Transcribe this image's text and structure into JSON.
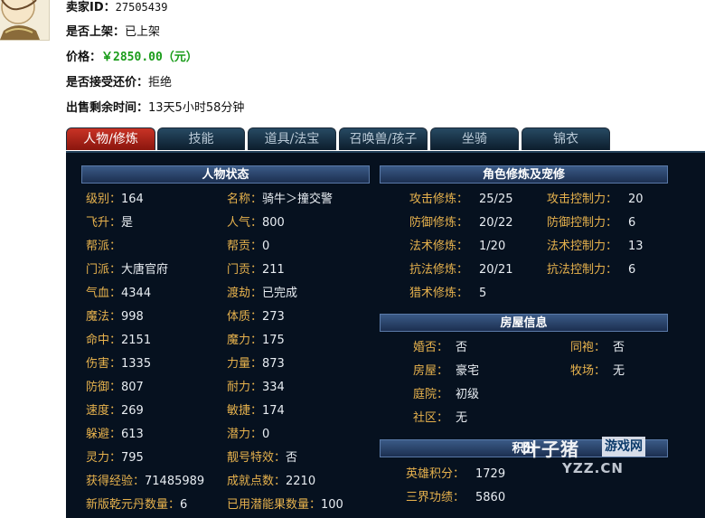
{
  "seller": {
    "seller_id_label": "卖家ID：",
    "seller_id": "27505439",
    "listed_label": "是否上架：",
    "listed": "已上架",
    "price_label": "价格：",
    "price": "￥2850.00（元）",
    "counter_offer_label": "是否接受还价：",
    "counter_offer": "拒绝",
    "time_left_label": "出售剩余时间：",
    "time_left": "13天5小时58分钟"
  },
  "tabs": [
    "人物/修炼",
    "技能",
    "道具/法宝",
    "召唤兽/孩子",
    "坐骑",
    "锦衣"
  ],
  "character": {
    "title": "人物状态",
    "rows": [
      [
        {
          "k": "级别：",
          "v": "164"
        },
        {
          "k": "名称：",
          "v": "骑牛＞撞交警"
        }
      ],
      [
        {
          "k": "飞升：",
          "v": "是"
        },
        {
          "k": "人气：",
          "v": "800"
        }
      ],
      [
        {
          "k": "帮派：",
          "v": ""
        },
        {
          "k": "帮贡：",
          "v": "0"
        }
      ],
      [
        {
          "k": "门派：",
          "v": "大唐官府"
        },
        {
          "k": "门贡：",
          "v": "211"
        }
      ],
      [
        {
          "k": "气血：",
          "v": "4344"
        },
        {
          "k": "渡劫：",
          "v": "已完成"
        }
      ],
      [
        {
          "k": "魔法：",
          "v": "998"
        },
        {
          "k": "体质：",
          "v": "273"
        }
      ],
      [
        {
          "k": "命中：",
          "v": "2151"
        },
        {
          "k": "魔力：",
          "v": "175"
        }
      ],
      [
        {
          "k": "伤害：",
          "v": "1335"
        },
        {
          "k": "力量：",
          "v": "873"
        }
      ],
      [
        {
          "k": "防御：",
          "v": "807"
        },
        {
          "k": "耐力：",
          "v": "334"
        }
      ],
      [
        {
          "k": "速度：",
          "v": "269"
        },
        {
          "k": "敏捷：",
          "v": "174"
        }
      ],
      [
        {
          "k": "躲避：",
          "v": "613"
        },
        {
          "k": "潜力：",
          "v": "0"
        }
      ],
      [
        {
          "k": "灵力：",
          "v": "795"
        },
        {
          "k": "靓号特效：",
          "v": "否"
        }
      ],
      [
        {
          "k": "获得经验：",
          "v": "71485989"
        },
        {
          "k": "成就点数：",
          "v": "2210"
        }
      ],
      [
        {
          "k": "新版乾元丹数量：",
          "v": "6"
        },
        {
          "k": "已用潜能果数量：",
          "v": "100"
        }
      ]
    ]
  },
  "cultivation": {
    "title": "角色修炼及宠修",
    "rows": [
      [
        {
          "k": "攻击修炼：",
          "v": "25/25"
        },
        {
          "k": "攻击控制力：",
          "v": "20"
        }
      ],
      [
        {
          "k": "防御修炼：",
          "v": "20/22"
        },
        {
          "k": "防御控制力：",
          "v": "6"
        }
      ],
      [
        {
          "k": "法术修炼：",
          "v": "1/20"
        },
        {
          "k": "法术控制力：",
          "v": "13"
        }
      ],
      [
        {
          "k": "抗法修炼：",
          "v": "20/21"
        },
        {
          "k": "抗法控制力：",
          "v": "6"
        }
      ],
      [
        {
          "k": "猎术修炼：",
          "v": "5"
        }
      ]
    ]
  },
  "house": {
    "title": "房屋信息",
    "rows": [
      [
        {
          "k": "婚否：",
          "v": "否"
        },
        {
          "k": "同袍：",
          "v": "否"
        }
      ],
      [
        {
          "k": "房屋：",
          "v": "豪宅"
        },
        {
          "k": "牧场：",
          "v": "无"
        }
      ],
      [
        {
          "k": "庭院：",
          "v": "初级"
        }
      ],
      [
        {
          "k": "社区：",
          "v": "无"
        }
      ]
    ]
  },
  "points": {
    "title": "积分",
    "rows": [
      [
        {
          "k": "英雄积分：",
          "v": "1729"
        }
      ],
      [
        {
          "k": "三界功绩：",
          "v": "5860"
        }
      ]
    ]
  },
  "watermark": {
    "logo": "叶子猪",
    "tag": "游戏网",
    "url": "YZZ.CN"
  }
}
